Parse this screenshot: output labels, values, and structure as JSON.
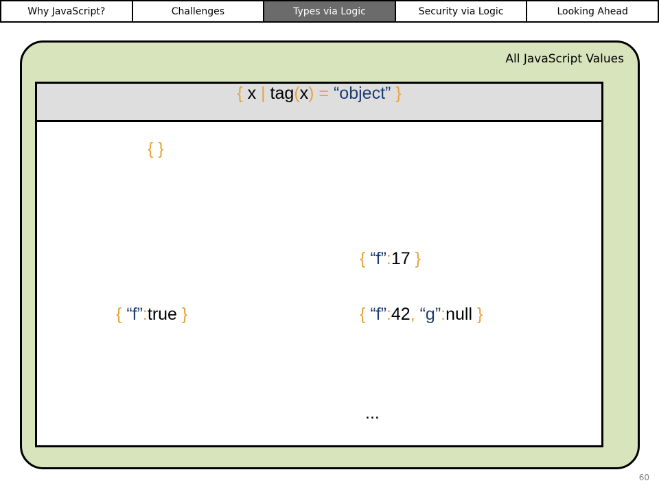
{
  "nav": {
    "tabs": [
      {
        "label": "Why JavaScript?",
        "active": false
      },
      {
        "label": "Challenges",
        "active": false
      },
      {
        "label": "Types via Logic",
        "active": true
      },
      {
        "label": "Security via Logic",
        "active": false
      },
      {
        "label": "Looking Ahead",
        "active": false
      }
    ]
  },
  "region": {
    "label": "All JavaScript Values"
  },
  "set": {
    "header": {
      "open_brace": "{",
      "var": "x",
      "bar": "|",
      "fn": "tag",
      "lparen": "(",
      "arg": "x",
      "rparen": ")",
      "eq": "=",
      "value": "“object”",
      "close_brace": "}"
    },
    "values": {
      "empty": "{ }",
      "f17": {
        "open": "{",
        "key": "“f”",
        "colon": ":",
        "val": "17",
        "close": "}"
      },
      "ftrue": {
        "open": "{",
        "key": "“f”",
        "colon": ":",
        "val": "true",
        "close": "}"
      },
      "f42g": {
        "open": "{",
        "key1": "“f”",
        "colon1": ":",
        "val1": "42",
        "comma": ",",
        "key2": "“g”",
        "colon2": ":",
        "val2": "null",
        "close": "}"
      },
      "ellipsis": "..."
    }
  },
  "footer": {
    "page_number": "60"
  },
  "colors": {
    "region_fill": "#d8e4bc",
    "header_fill": "#dedede",
    "active_tab": "#6b6b6b",
    "accent_orange": "#e8a33a",
    "token_blue": "#1f3d73"
  }
}
